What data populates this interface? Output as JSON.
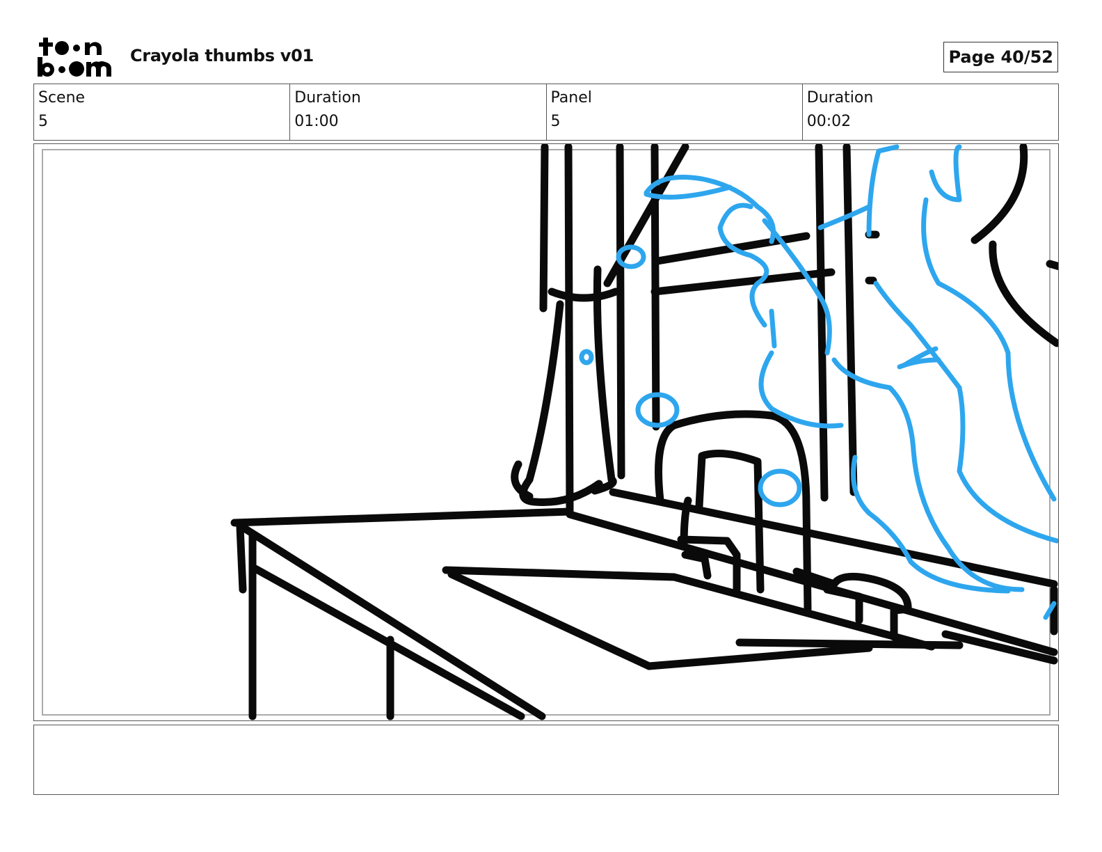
{
  "header": {
    "logo_text": "toon boom",
    "title": "Crayola thumbs v01",
    "page_label": "Page 40/52"
  },
  "info": [
    {
      "label": "Scene",
      "value": "5"
    },
    {
      "label": "Duration",
      "value": "01:00"
    },
    {
      "label": "Panel",
      "value": "5"
    },
    {
      "label": "Duration",
      "value": "00:02"
    }
  ],
  "colors": {
    "ink": "#0a0a0a",
    "water_blue": "#2ea6ee",
    "border": "#555555"
  },
  "notes": ""
}
